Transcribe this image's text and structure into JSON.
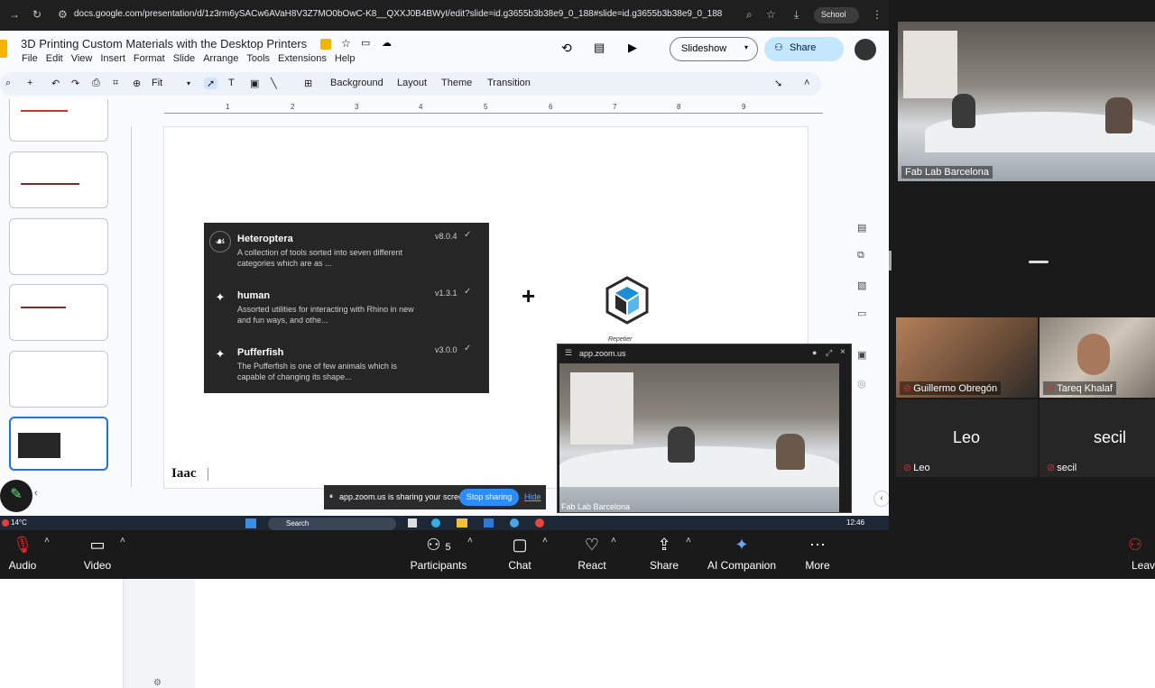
{
  "browser": {
    "url": "docs.google.com/presentation/d/1z3rm6ySACw6AVaH8V3Z7MO0bOwC-K8__QXXJ0B4BWyI/edit?slide=id.g3655b3b38e9_0_188#slide=id.g3655b3b38e9_0_188",
    "profile": "School"
  },
  "docs": {
    "title": "3D Printing Custom Materials with the Desktop Printers",
    "menu": [
      "File",
      "Edit",
      "View",
      "Insert",
      "Format",
      "Slide",
      "Arrange",
      "Tools",
      "Extensions",
      "Help"
    ],
    "slideshow_label": "Slideshow",
    "share_label": "Share",
    "zoom_label": "Fit",
    "toolbar_buttons": [
      "Background",
      "Layout",
      "Theme",
      "Transition"
    ],
    "ruler_ticks": [
      "1",
      "2",
      "3",
      "4",
      "5",
      "6",
      "7",
      "8",
      "9"
    ]
  },
  "slide": {
    "packages": [
      {
        "name": "Heteroptera",
        "desc": "A collection of tools  sorted into seven different categories which are as ...",
        "version": "v8.0.4",
        "icon": "bug-icon"
      },
      {
        "name": "human",
        "desc": "Assorted utilities for interacting with Rhino in new and fun ways, and othe...",
        "version": "v1.3.1",
        "icon": "package-icon"
      },
      {
        "name": "Pufferfish",
        "desc": "The Pufferfish is one of few animals which is capable of changing its shape...",
        "version": "v3.0.0",
        "icon": "package-icon"
      }
    ],
    "plus": "+",
    "logo_caption": "Repetier",
    "footer_logo": "Iaac"
  },
  "zoom_popup": {
    "title": "app.zoom.us",
    "tile_name": "Fab Lab Barcelona"
  },
  "sharing_bar": {
    "text": "app.zoom.us is sharing your screen.",
    "stop_label": "Stop sharing",
    "hide_label": "Hide"
  },
  "taskbar": {
    "weather": "14°C",
    "search": "Search",
    "time": "12:46"
  },
  "participants_panel": {
    "main_tile": "Fab Lab Barcelona",
    "tiles": [
      {
        "name": "Guillermo Obregón",
        "muted": true
      },
      {
        "name": "Tareq Khalaf",
        "muted": true
      },
      {
        "name": "Leo",
        "muted": true,
        "big": "Leo"
      },
      {
        "name": "secil",
        "muted": true,
        "big": "secil"
      }
    ]
  },
  "zoom_controls": {
    "audio": "Audio",
    "video": "Video",
    "participants": "Participants",
    "participants_count": "5",
    "chat": "Chat",
    "react": "React",
    "share": "Share",
    "ai": "AI Companion",
    "more": "More",
    "leave": "Leave"
  }
}
